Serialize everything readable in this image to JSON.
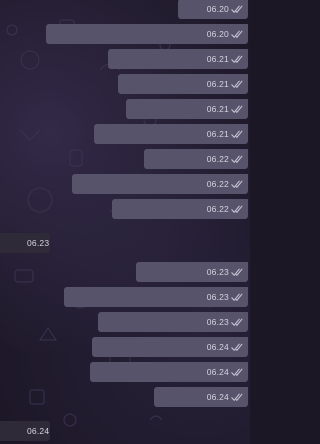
{
  "messages": [
    {
      "dir": "out",
      "time": "06.20",
      "status": "read"
    },
    {
      "dir": "out",
      "time": "06.20",
      "status": "read"
    },
    {
      "dir": "out",
      "time": "06.21",
      "status": "read"
    },
    {
      "dir": "out",
      "time": "06.21",
      "status": "read"
    },
    {
      "dir": "out",
      "time": "06.21",
      "status": "read"
    },
    {
      "dir": "out",
      "time": "06.21",
      "status": "read"
    },
    {
      "dir": "out",
      "time": "06.22",
      "status": "read"
    },
    {
      "dir": "out",
      "time": "06.22",
      "status": "read"
    },
    {
      "dir": "out",
      "time": "06.22",
      "status": "read"
    },
    {
      "dir": "in",
      "time": "06.23"
    },
    {
      "dir": "out",
      "time": "06.23",
      "status": "read"
    },
    {
      "dir": "out",
      "time": "06.23",
      "status": "read"
    },
    {
      "dir": "out",
      "time": "06.23",
      "status": "read"
    },
    {
      "dir": "out",
      "time": "06.24",
      "status": "read"
    },
    {
      "dir": "out",
      "time": "06.24",
      "status": "read"
    },
    {
      "dir": "out",
      "time": "06.24",
      "status": "read"
    },
    {
      "dir": "in",
      "time": "06.24"
    }
  ],
  "icons": {
    "read_receipt": "double-check-icon"
  },
  "colors": {
    "outgoing_bubble": "#57536a",
    "incoming_bubble": "#2e2a37",
    "tick": "#c9c5d6"
  }
}
